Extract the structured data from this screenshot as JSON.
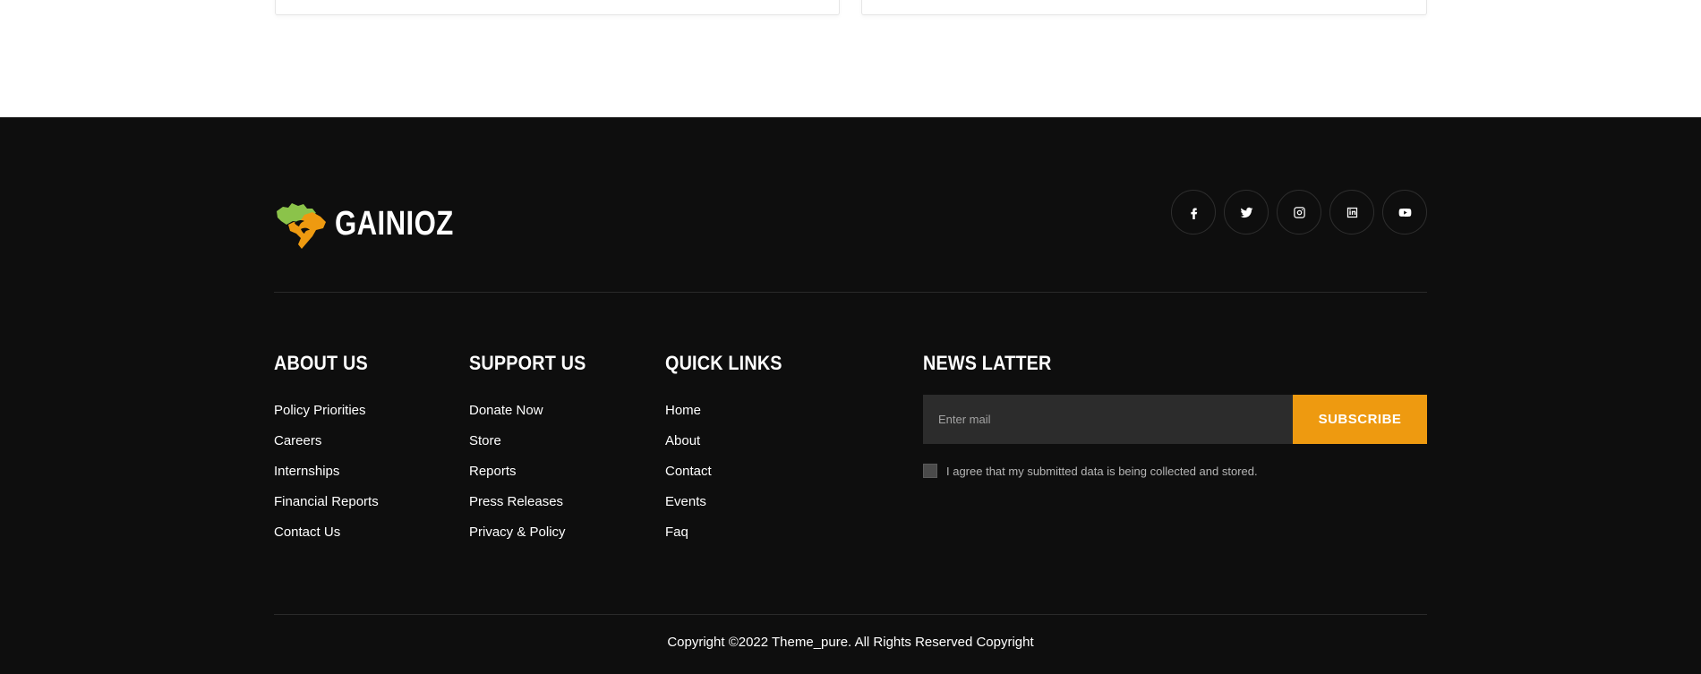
{
  "brand": {
    "name": "GAINIOZ",
    "colors": {
      "accent": "#ee9a10",
      "leaf_green": "#8bc34a",
      "footer_bg": "#0e0e0e"
    }
  },
  "socials": [
    {
      "name": "facebook-icon"
    },
    {
      "name": "twitter-icon"
    },
    {
      "name": "instagram-icon"
    },
    {
      "name": "linkedin-icon"
    },
    {
      "name": "youtube-icon"
    }
  ],
  "footer": {
    "about": {
      "title": "ABOUT US",
      "links": [
        "Policy Priorities",
        "Careers",
        "Internships",
        "Financial Reports",
        "Contact Us"
      ]
    },
    "support": {
      "title": "SUPPORT US",
      "links": [
        "Donate Now",
        "Store",
        "Reports",
        "Press Releases",
        "Privacy & Policy"
      ]
    },
    "quick": {
      "title": "QUICK LINKS",
      "links": [
        "Home",
        "About",
        "Contact",
        "Events",
        "Faq"
      ]
    },
    "newsletter": {
      "title": "NEWS LATTER",
      "input_placeholder": "Enter mail",
      "input_value": "",
      "button_label": "SUBSCRIBE",
      "agree_text": "I agree that my submitted data is being collected and stored."
    },
    "copyright": "Copyright ©2022 Theme_pure. All Rights Reserved Copyright"
  }
}
